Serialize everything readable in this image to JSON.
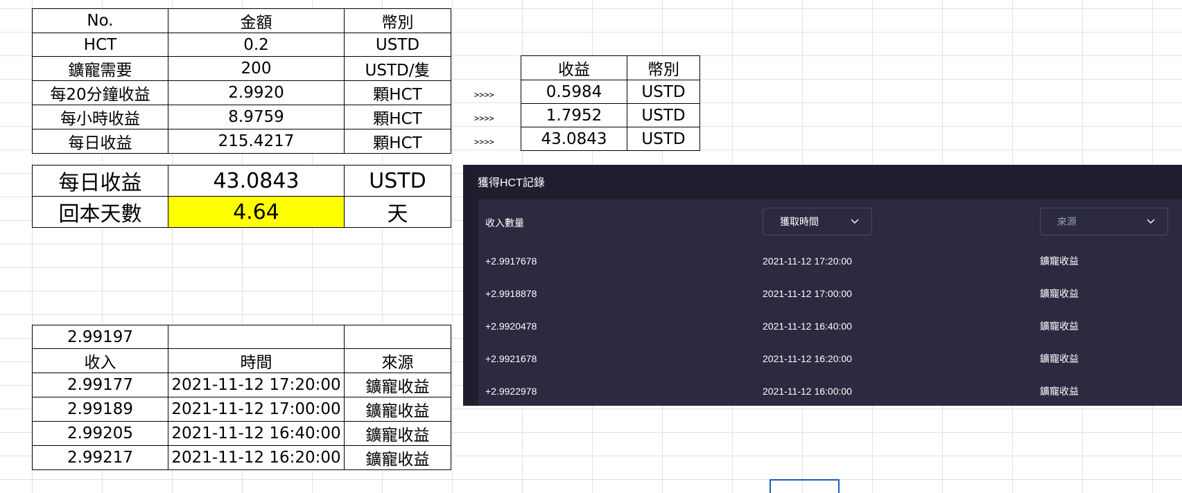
{
  "table1": {
    "header": [
      "No.",
      "金額",
      "幣別"
    ],
    "rows": [
      [
        "HCT",
        "0.2",
        "USTD"
      ],
      [
        "鑛寵需要",
        "200",
        "USTD/隻"
      ],
      [
        "每20分鐘收益",
        "2.9920",
        "顆HCT"
      ],
      [
        "每小時收益",
        "8.9759",
        "顆HCT"
      ],
      [
        "每日收益",
        "215.4217",
        "顆HCT"
      ]
    ]
  },
  "table2": {
    "header": [
      "收益",
      "幣別"
    ],
    "rows": [
      [
        "0.5984",
        "USTD"
      ],
      [
        "1.7952",
        "USTD"
      ],
      [
        "43.0843",
        "USTD"
      ]
    ]
  },
  "arrows": [
    ">>>>",
    ">>>>",
    ">>>>"
  ],
  "table3": {
    "rows": [
      [
        "每日收益",
        "43.0843",
        "USTD"
      ],
      [
        "回本天數",
        "4.64",
        "天"
      ]
    ],
    "highlight_color": "#ffff00"
  },
  "table4": {
    "top_value": "2.99197",
    "header": [
      "收入",
      "時間",
      "來源"
    ],
    "rows": [
      [
        "2.99177",
        "2021-11-12 17:20:00",
        "鑛寵收益"
      ],
      [
        "2.99189",
        "2021-11-12 17:00:00",
        "鑛寵收益"
      ],
      [
        "2.99205",
        "2021-11-12 16:40:00",
        "鑛寵收益"
      ],
      [
        "2.99217",
        "2021-11-12 16:20:00",
        "鑛寵收益"
      ]
    ]
  },
  "panel": {
    "title": "獲得HCT記錄",
    "col_amount": "收入數量",
    "dropdown_time": "獲取時間",
    "dropdown_source": "來源",
    "records": [
      {
        "amount": "+2.9917678",
        "time": "2021-11-12 17:20:00",
        "source": "鑛寵收益"
      },
      {
        "amount": "+2.9918878",
        "time": "2021-11-12 17:00:00",
        "source": "鑛寵收益"
      },
      {
        "amount": "+2.9920478",
        "time": "2021-11-12 16:40:00",
        "source": "鑛寵收益"
      },
      {
        "amount": "+2.9921678",
        "time": "2021-11-12 16:20:00",
        "source": "鑛寵收益"
      },
      {
        "amount": "+2.9922978",
        "time": "2021-11-12 16:00:00",
        "source": "鑛寵收益"
      }
    ],
    "colors": {
      "background": "#1f1e2e",
      "inner": "#2b2a40",
      "placeholder": "#9d9cbf"
    }
  },
  "icons": {
    "dropdown": "chevron-down-icon"
  }
}
